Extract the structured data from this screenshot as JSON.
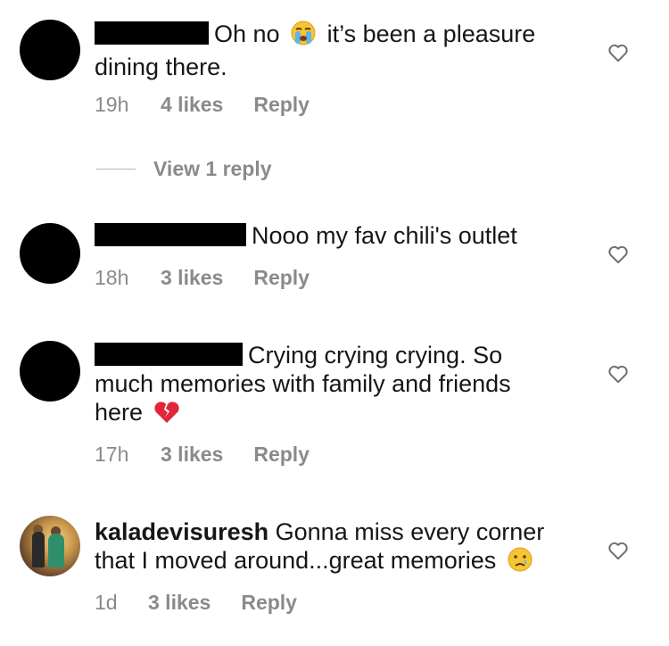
{
  "comments": [
    {
      "text_before": "Oh no",
      "text_after": " it’s been a pleasure dining there.",
      "time": "19h",
      "likes": "4 likes",
      "reply": "Reply",
      "emoji": "loudly-crying-face"
    },
    {
      "text": "Nooo my fav chili's outlet",
      "time": "18h",
      "likes": "3 likes",
      "reply": "Reply"
    },
    {
      "text": "Crying crying crying. So much memories with family and friends here",
      "time": "17h",
      "likes": "3 likes",
      "reply": "Reply",
      "emoji": "broken-heart"
    },
    {
      "username": "kaladevisuresh",
      "text": "Gonna miss every corner that I moved around...great memories",
      "time": "1d",
      "likes": "3 likes",
      "reply": "Reply",
      "emoji": "crying-face"
    }
  ],
  "view_replies": "View 1 reply",
  "colors": {
    "text": "#161616",
    "meta": "#8a8a8a",
    "redaction": "#000000"
  }
}
